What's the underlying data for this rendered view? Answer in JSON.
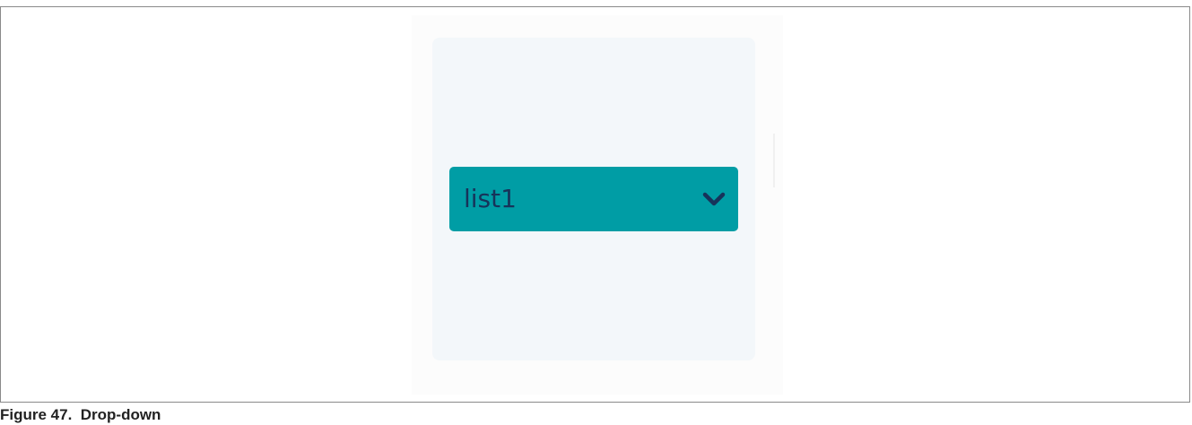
{
  "dropdown": {
    "selected_value": "list1",
    "icon": "chevron-down-icon",
    "background_color": "#009da5",
    "text_color": "#17335a"
  },
  "panel": {
    "background_color": "#f3f7fa"
  },
  "caption": {
    "text": "Figure 47.  Drop-down"
  }
}
